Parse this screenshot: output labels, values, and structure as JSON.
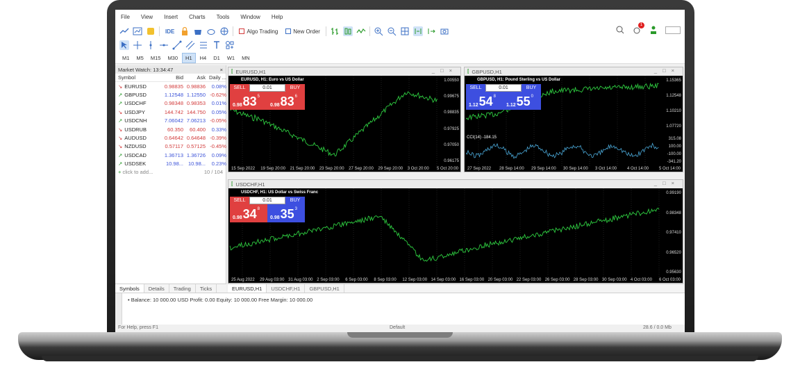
{
  "menu": [
    "File",
    "View",
    "Insert",
    "Charts",
    "Tools",
    "Window",
    "Help"
  ],
  "toolbar": {
    "ide_label": "IDE",
    "algo_label": "Algo Trading",
    "new_order_label": "New Order",
    "notification_count": "1"
  },
  "timeframes": [
    "M1",
    "M5",
    "M15",
    "M30",
    "H1",
    "H4",
    "D1",
    "W1",
    "MN"
  ],
  "timeframe_active": "H1",
  "market_watch": {
    "title": "Market Watch: 13:34:47",
    "headers": [
      "Symbol",
      "Bid",
      "Ask",
      "Daily ..."
    ],
    "rows": [
      {
        "symbol": "EURUSD",
        "dir": "down",
        "bid": "0.98835",
        "ask": "0.98836",
        "daily": "0.08%",
        "color": "red"
      },
      {
        "symbol": "GBPUSD",
        "dir": "up",
        "bid": "1.12548",
        "ask": "1.12550",
        "daily": "-0.62%",
        "color": "blue"
      },
      {
        "symbol": "USDCHF",
        "dir": "up",
        "bid": "0.98348",
        "ask": "0.98353",
        "daily": "0.01%",
        "color": "red"
      },
      {
        "symbol": "USDJPY",
        "dir": "down",
        "bid": "144.742",
        "ask": "144.750",
        "daily": "0.05%",
        "color": "red"
      },
      {
        "symbol": "USDCNH",
        "dir": "up",
        "bid": "7.06042",
        "ask": "7.06213",
        "daily": "-0.05%",
        "color": "blue"
      },
      {
        "symbol": "USDRUB",
        "dir": "down",
        "bid": "60.350",
        "ask": "60.400",
        "daily": "0.33%",
        "color": "red"
      },
      {
        "symbol": "AUDUSD",
        "dir": "down",
        "bid": "0.64642",
        "ask": "0.64648",
        "daily": "-0.39%",
        "color": "red"
      },
      {
        "symbol": "NZDUSD",
        "dir": "down",
        "bid": "0.57117",
        "ask": "0.57125",
        "daily": "-0.45%",
        "color": "red"
      },
      {
        "symbol": "USDCAD",
        "dir": "up",
        "bid": "1.36713",
        "ask": "1.36726",
        "daily": "0.09%",
        "color": "blue"
      },
      {
        "symbol": "USDSEK",
        "dir": "up",
        "bid": "10.98...",
        "ask": "10.98...",
        "daily": "0.23%",
        "color": "blue"
      }
    ],
    "add_label": "click to add...",
    "count": "10 / 104",
    "tabs": [
      "Symbols",
      "Details",
      "Trading",
      "Ticks"
    ]
  },
  "charts": {
    "eurusd": {
      "window_title": "EURUSD,H1",
      "label": "EURUSD, H1:  Euro vs US Dollar",
      "sell": "SELL",
      "buy": "BUY",
      "lot": "0.01",
      "sell_price": {
        "small": "0.98",
        "big": "83",
        "sup": "5"
      },
      "buy_price": {
        "small": "0.98",
        "big": "83",
        "sup": "6"
      },
      "prices": [
        "1.00550",
        "0.99675",
        "0.98835",
        "0.97925",
        "0.97050",
        "0.96175"
      ],
      "times": [
        "15 Sep 2022",
        "19 Sep 20:00",
        "21 Sep 20:00",
        "23 Sep 20:00",
        "27 Sep 20:00",
        "29 Sep 20:00",
        "3 Oct 20:00",
        "5 Oct 20:00"
      ]
    },
    "gbpusd": {
      "window_title": "GBPUSD,H1",
      "label": "GBPUSD, H1:  Pound Sterling vs US Dollar",
      "sell": "SELL",
      "buy": "BUY",
      "lot": "0.01",
      "sell_price": {
        "small": "1.12",
        "big": "54",
        "sup": "8"
      },
      "buy_price": {
        "small": "1.12",
        "big": "55",
        "sup": "0"
      },
      "prices": [
        "1.15365",
        "1.12548",
        "1.10210",
        "1.07720"
      ],
      "cci_label": "CCI(14) -184.15",
      "cci_prices": [
        "315.08",
        "100.00",
        "-100.00",
        "-341.20"
      ],
      "times": [
        "27 Sep 2022",
        "28 Sep 14:00",
        "29 Sep 14:00",
        "30 Sep 14:00",
        "3 Oct 14:00",
        "4 Oct 14:00",
        "5 Oct 14:00"
      ]
    },
    "usdchf": {
      "window_title": "USDCHF,H1",
      "label": "USDCHF, H1:  US Dollar vs Swiss Franc",
      "sell": "SELL",
      "buy": "BUY",
      "lot": "0.01",
      "sell_price": {
        "small": "0.98",
        "big": "34",
        "sup": "8"
      },
      "buy_price": {
        "small": "0.98",
        "big": "35",
        "sup": "3"
      },
      "prices": [
        "0.99190",
        "0.98348",
        "0.97410",
        "0.96520",
        "0.95630"
      ],
      "times": [
        "25 Aug 2022",
        "29 Aug 03:00",
        "31 Aug 03:00",
        "2 Sep 03:00",
        "6 Sep 03:00",
        "8 Sep 03:00",
        "12 Sep 03:00",
        "14 Sep 03:00",
        "16 Sep 03:00",
        "20 Sep 03:00",
        "22 Sep 03:00",
        "26 Sep 03:00",
        "28 Sep 03:00",
        "30 Sep 03:00",
        "4 Oct 03:00",
        "6 Oct 03:00"
      ]
    }
  },
  "chart_tabs": [
    "EURUSD,H1",
    "USDCHF,H1",
    "GBPUSD,H1"
  ],
  "toolbox": {
    "balance_text": "Balance: 10 000.00 USD  Profit: 0.00  Equity: 10 000.00  Free Margin: 10 000.00"
  },
  "statusbar": {
    "help": "For Help, press F1",
    "profile": "Default",
    "connection": "28.6 / 0.0 Mb"
  }
}
